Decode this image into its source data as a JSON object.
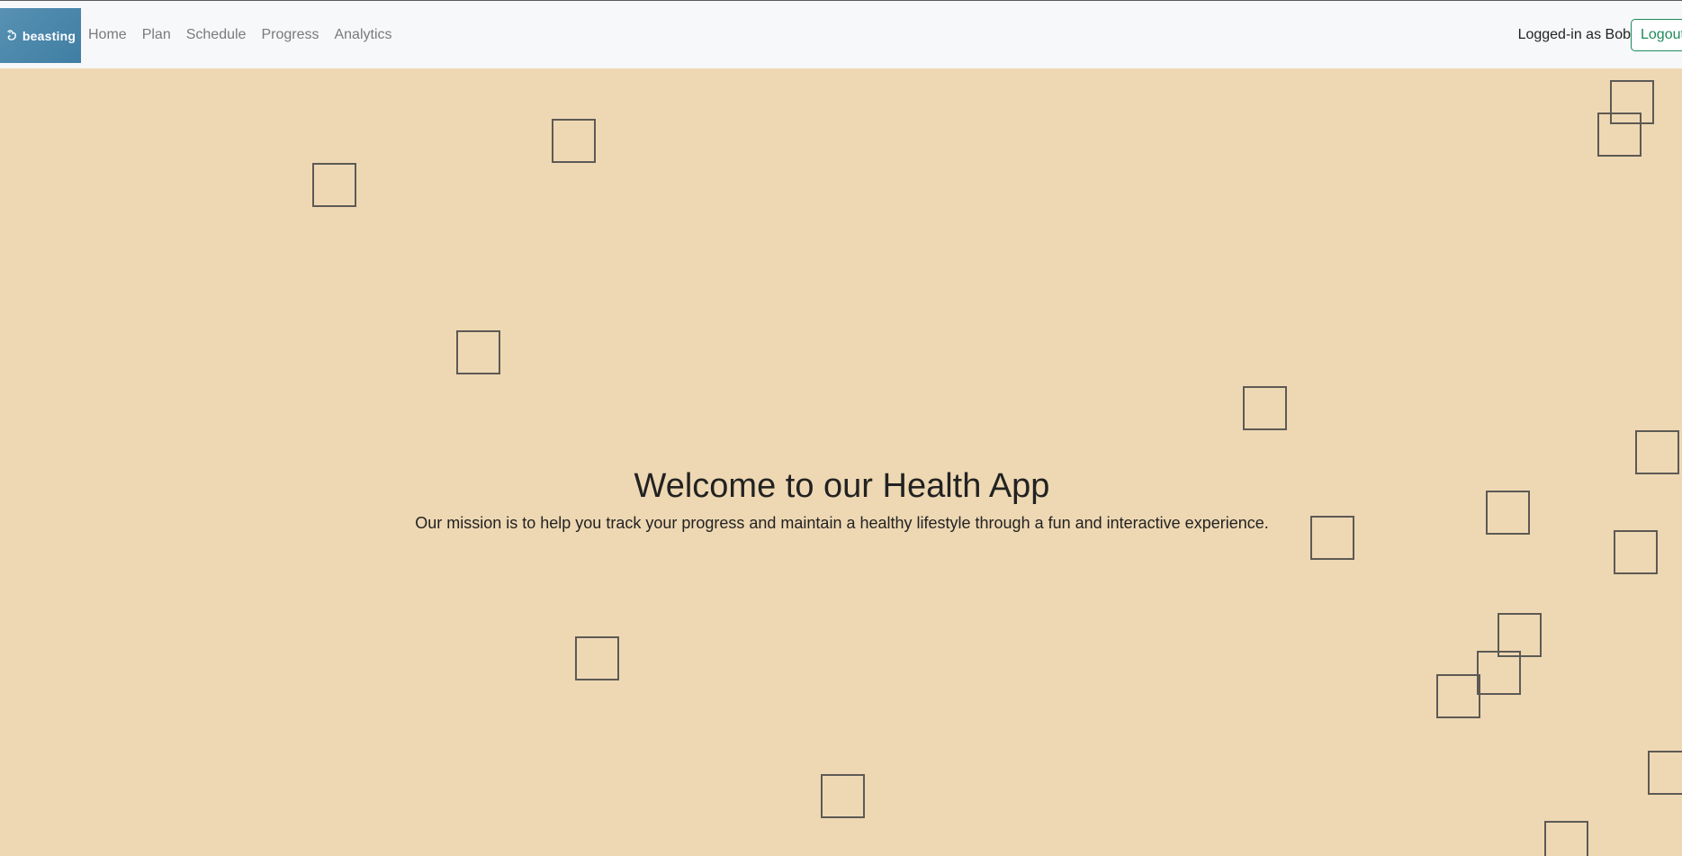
{
  "navbar": {
    "logo_text": "beasting",
    "links": [
      "Home",
      "Plan",
      "Schedule",
      "Progress",
      "Analytics"
    ],
    "user_label": "Logged-in as Bob",
    "logout_label": "Logout"
  },
  "hero": {
    "title": "Welcome to our Health App",
    "subtitle": "Our mission is to help you track your progress and maintain a healthy lifestyle through a fun and interactive experience."
  },
  "colors": {
    "background": "#eed8b3",
    "navbar": "#f7f8fa",
    "logo_gradient": "#4a88ad",
    "logout_accent": "#1f8a5a",
    "square_stroke": "#5d5a55"
  },
  "decor": {
    "shape": "outlined-square",
    "count": 22
  }
}
